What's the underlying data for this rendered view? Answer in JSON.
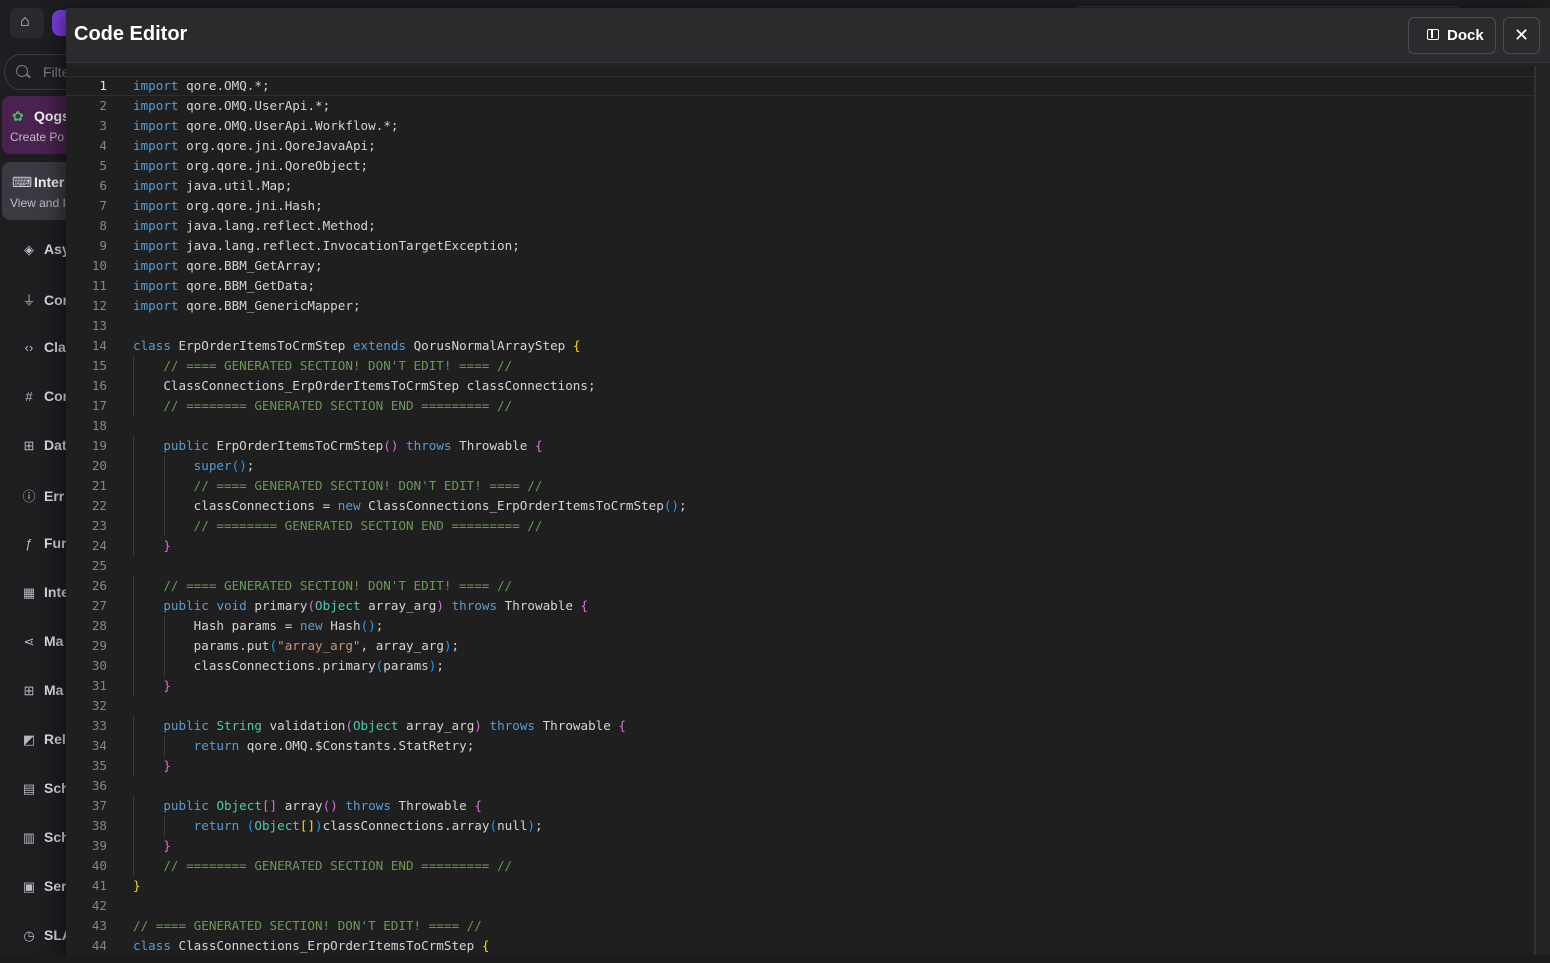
{
  "background": {
    "filter_placeholder": "Filte",
    "cards": [
      {
        "title": "Qogs",
        "subtitle": "Create Po",
        "icon": "qog-icon"
      },
      {
        "title": "Inter",
        "subtitle": "View and I",
        "icon": "code-box-icon"
      }
    ],
    "nav_items": [
      {
        "label": "Asy",
        "icon": "layers-icon",
        "glyph": "◈"
      },
      {
        "label": "Cor",
        "icon": "plug-icon",
        "glyph": "⏚"
      },
      {
        "label": "Cla",
        "icon": "code-brackets-icon",
        "glyph": "‹›"
      },
      {
        "label": "Cor",
        "icon": "hash-icon",
        "glyph": "#"
      },
      {
        "label": "Dat",
        "icon": "hierarchy-icon",
        "glyph": "⊞"
      },
      {
        "label": "Err",
        "icon": "error-icon",
        "glyph": "ⓘ"
      },
      {
        "label": "Fur",
        "icon": "function-icon",
        "glyph": "ƒ"
      },
      {
        "label": "Inte",
        "icon": "grid-icon",
        "glyph": "▦"
      },
      {
        "label": "Ma",
        "icon": "share-icon",
        "glyph": "⋖"
      },
      {
        "label": "Ma",
        "icon": "apps-icon",
        "glyph": "⊞"
      },
      {
        "label": "Rel",
        "icon": "release-icon",
        "glyph": "◩"
      },
      {
        "label": "Sch",
        "icon": "calendar-icon",
        "glyph": "▤"
      },
      {
        "label": "Sch",
        "icon": "schema-icon",
        "glyph": "▥"
      },
      {
        "label": "Ser",
        "icon": "service-icon",
        "glyph": "▣"
      },
      {
        "label": "SLA",
        "icon": "stopwatch-icon",
        "glyph": "◷"
      }
    ]
  },
  "modal": {
    "title": "Code Editor",
    "dock_label": "Dock",
    "dock_icon": "panel-left-icon",
    "close_glyph": "✕",
    "close_icon": "close-icon"
  },
  "editor": {
    "current_line": 1,
    "language": "java",
    "lines": [
      "import qore.OMQ.*;",
      "import qore.OMQ.UserApi.*;",
      "import qore.OMQ.UserApi.Workflow.*;",
      "import org.qore.jni.QoreJavaApi;",
      "import org.qore.jni.QoreObject;",
      "import java.util.Map;",
      "import org.qore.jni.Hash;",
      "import java.lang.reflect.Method;",
      "import java.lang.reflect.InvocationTargetException;",
      "import qore.BBM_GetArray;",
      "import qore.BBM_GetData;",
      "import qore.BBM_GenericMapper;",
      "",
      "class ErpOrderItemsToCrmStep extends QorusNormalArrayStep {",
      "    // ==== GENERATED SECTION! DON'T EDIT! ==== //",
      "    ClassConnections_ErpOrderItemsToCrmStep classConnections;",
      "    // ======== GENERATED SECTION END ========= //",
      "",
      "    public ErpOrderItemsToCrmStep() throws Throwable {",
      "        super();",
      "        // ==== GENERATED SECTION! DON'T EDIT! ==== //",
      "        classConnections = new ClassConnections_ErpOrderItemsToCrmStep();",
      "        // ======== GENERATED SECTION END ========= //",
      "    }",
      "",
      "    // ==== GENERATED SECTION! DON'T EDIT! ==== //",
      "    public void primary(Object array_arg) throws Throwable {",
      "        Hash params = new Hash();",
      "        params.put(\"array_arg\", array_arg);",
      "        classConnections.primary(params);",
      "    }",
      "",
      "    public String validation(Object array_arg) throws Throwable {",
      "        return qore.OMQ.$Constants.StatRetry;",
      "    }",
      "",
      "    public Object[] array() throws Throwable {",
      "        return (Object[])classConnections.array(null);",
      "    }",
      "    // ======== GENERATED SECTION END ========= //",
      "}",
      "",
      "// ==== GENERATED SECTION! DON'T EDIT! ==== //",
      "class ClassConnections_ErpOrderItemsToCrmStep {"
    ]
  }
}
